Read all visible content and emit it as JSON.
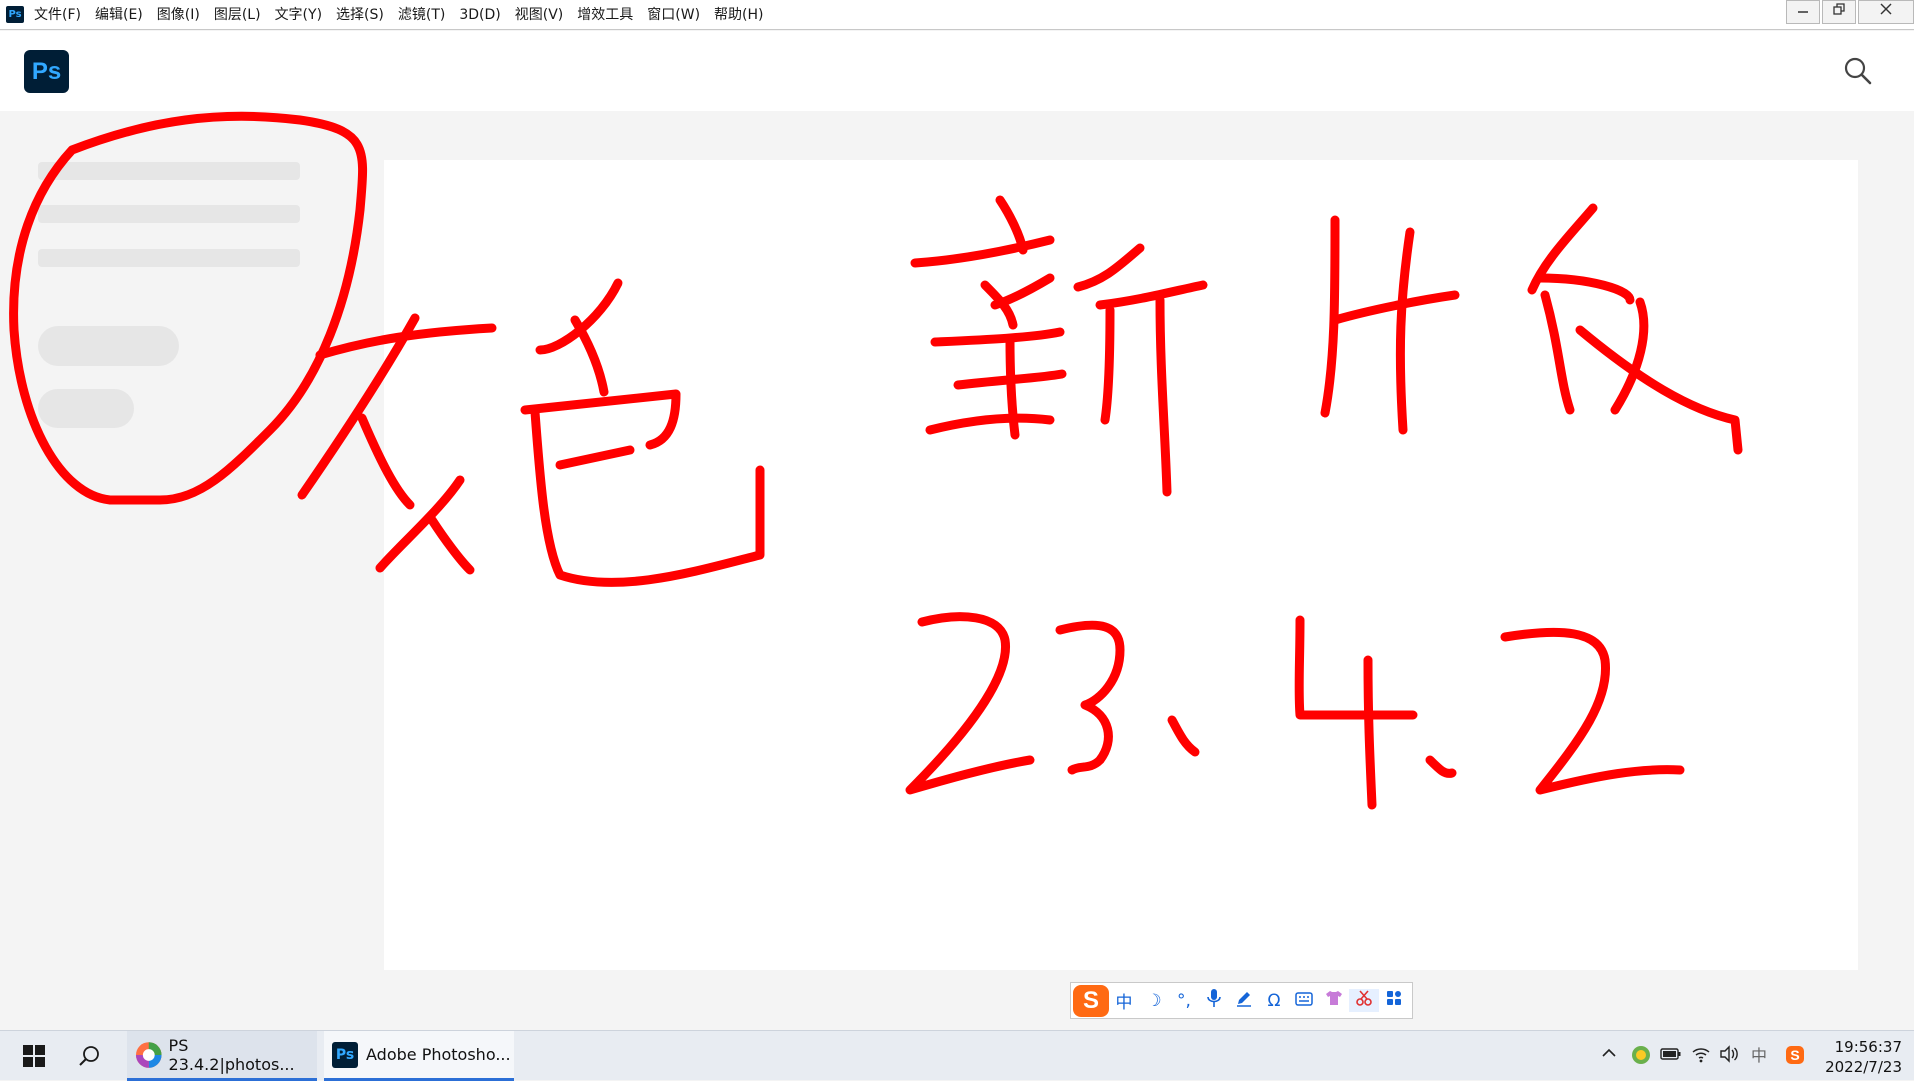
{
  "menubar": {
    "app_icon": "Ps",
    "items": [
      "文件(F)",
      "编辑(E)",
      "图像(I)",
      "图层(L)",
      "文字(Y)",
      "选择(S)",
      "滤镜(T)",
      "3D(D)",
      "视图(V)",
      "增效工具",
      "窗口(W)",
      "帮助(H)"
    ],
    "controls": {
      "minimize": "minimize-icon",
      "restore": "restore-icon",
      "close": "close-icon"
    }
  },
  "home": {
    "logo_text": "Ps",
    "search_icon": "search-icon"
  },
  "annotation": {
    "color": "#ff0000",
    "texts": [
      "灰色",
      "新版",
      "23.4.2"
    ]
  },
  "ime_toolbar": {
    "logo": "S",
    "items": [
      "中",
      "☽",
      "°,",
      "mic-icon",
      "pen-icon",
      "Ω",
      "keyboard-icon",
      "shirt-icon",
      "scissors-icon",
      "apps-icon"
    ]
  },
  "taskbar": {
    "apps": [
      {
        "label": "PS 23.4.2|photos...",
        "icon": "browser-icon"
      },
      {
        "label": "Adobe Photosho...",
        "icon": "Ps"
      }
    ],
    "time": "19:56:37",
    "date": "2022/7/23",
    "ime_tray": "中"
  }
}
